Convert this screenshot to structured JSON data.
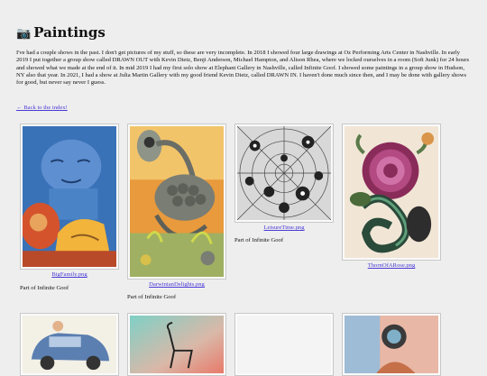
{
  "page": {
    "title": "Paintings",
    "title_icon": "camera-icon",
    "intro": "I've had a couple shows in the past. I don't get pictures of my stuff, so these are very incomplete. In 2018 I showed four large drawings at Oz Performing Arts Center in Nashville. In early 2019 I put together a group show called DRAWN OUT with Kevin Dietz, Benji Anderson, Michael Hampton, and Alison Rhea, where we locked ourselves in a room (Soft Junk) for 24 hours and showed what we made at the end of it. In mid 2019 I had my first solo show at Elephant Gallery in Nashville, called Infinite Goof. I showed some paintings in a group show in Hudson, NY also that year. In 2021, I had a show at Julia Martin Gallery with my good friend Kevin Dietz, called DRAWN IN. I haven't done much since then, and I may be done with gallery shows for good, but never say never I guess.",
    "back_link": "← Back to the index!"
  },
  "gallery": [
    {
      "file": "BigFamily.png",
      "caption": "Part of Infinite Goof",
      "icon": "painting-big-family"
    },
    {
      "file": "DarwinianDelights.png",
      "caption": "Part of Infinite Goof",
      "icon": "painting-darwinian-delights"
    },
    {
      "file": "LeisureTime.png",
      "caption": "Part of Infinite Goof",
      "icon": "painting-leisure-time"
    },
    {
      "file": "ThornOfARose.png",
      "caption": "",
      "icon": "painting-thorn-of-a-rose"
    },
    {
      "file": "",
      "caption": "",
      "icon": "painting-car"
    },
    {
      "file": "",
      "caption": "",
      "icon": "painting-chair"
    },
    {
      "file": "",
      "caption": "",
      "icon": "painting-blank"
    },
    {
      "file": "",
      "caption": "",
      "icon": "painting-figure"
    }
  ],
  "colors": {
    "background": "#eeeeee",
    "link": "#4b3bd6"
  }
}
